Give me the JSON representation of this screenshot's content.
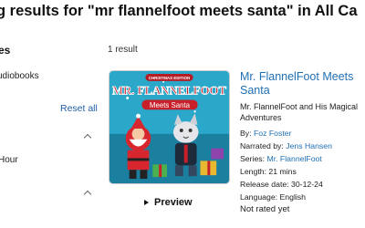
{
  "search": {
    "heading": "g results for \"mr flannelfoot meets santa\" in All Ca",
    "result_count": "1 result"
  },
  "sidebar": {
    "heading": "es",
    "audiobooks_label": "udiobooks",
    "reset_label": "Reset all",
    "hour_label": "Hour"
  },
  "result": {
    "cover": {
      "title_line1": "MR. FLANNELFOOT",
      "title_line2": "Meets Santa",
      "badge": "CHRISTMAS EDITION"
    },
    "title": "Mr. FlannelFoot Meets Santa",
    "subtitle": "Mr. FlannelFoot and His Magical Adventures",
    "author_label": "By: ",
    "author": "Foz Foster",
    "narrator_label": "Narrated by: ",
    "narrator": "Jens Hansen",
    "series_label": "Series: ",
    "series": "Mr. FlannelFoot",
    "length": "Length: 21 mins",
    "release_date": "Release date: 30-12-24",
    "language": "Language: English",
    "rating": "Not rated yet",
    "preview_label": "Preview"
  },
  "colors": {
    "link": "#1f6fb3",
    "cover_sky": "#2aa7c9",
    "cover_title_red": "#c8202a"
  }
}
